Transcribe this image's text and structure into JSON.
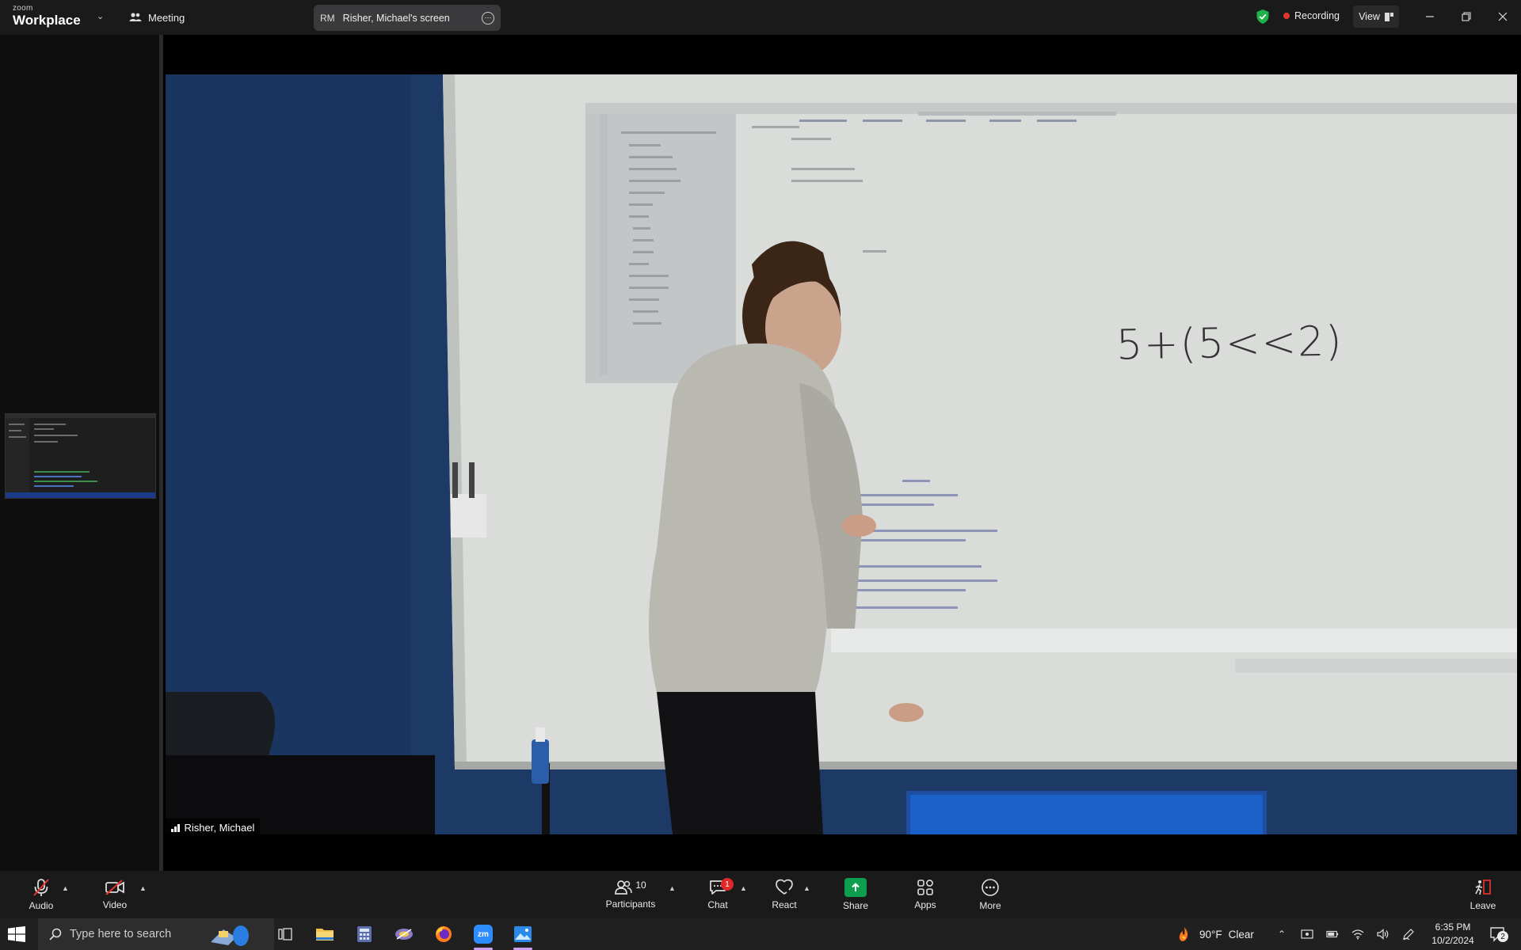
{
  "app": {
    "brand_small": "zoom",
    "brand_big": "Workplace"
  },
  "topbar": {
    "meeting_label": "Meeting",
    "screen_pill": {
      "initials": "RM",
      "label": "Risher, Michael's screen"
    },
    "recording_label": "Recording",
    "view_label": "View"
  },
  "video": {
    "participant_name": "Risher, Michael",
    "whiteboard_text": "5+(5<<2)"
  },
  "toolbar": {
    "audio_label": "Audio",
    "video_label": "Video",
    "participants_label": "Participants",
    "participants_count": "10",
    "chat_label": "Chat",
    "chat_badge": "1",
    "react_label": "React",
    "share_label": "Share",
    "apps_label": "Apps",
    "more_label": "More",
    "leave_label": "Leave"
  },
  "taskbar": {
    "search_placeholder": "Type here to search",
    "zoom_app_label": "zm",
    "temperature": "90°F",
    "weather_condition": "Clear",
    "time": "6:35 PM",
    "date": "10/2/2024",
    "notification_count": "2"
  },
  "colors": {
    "accent_share": "#0e9f4e",
    "recording_dot": "#e5352f",
    "badge": "#e02828",
    "shield": "#1fb24a"
  }
}
